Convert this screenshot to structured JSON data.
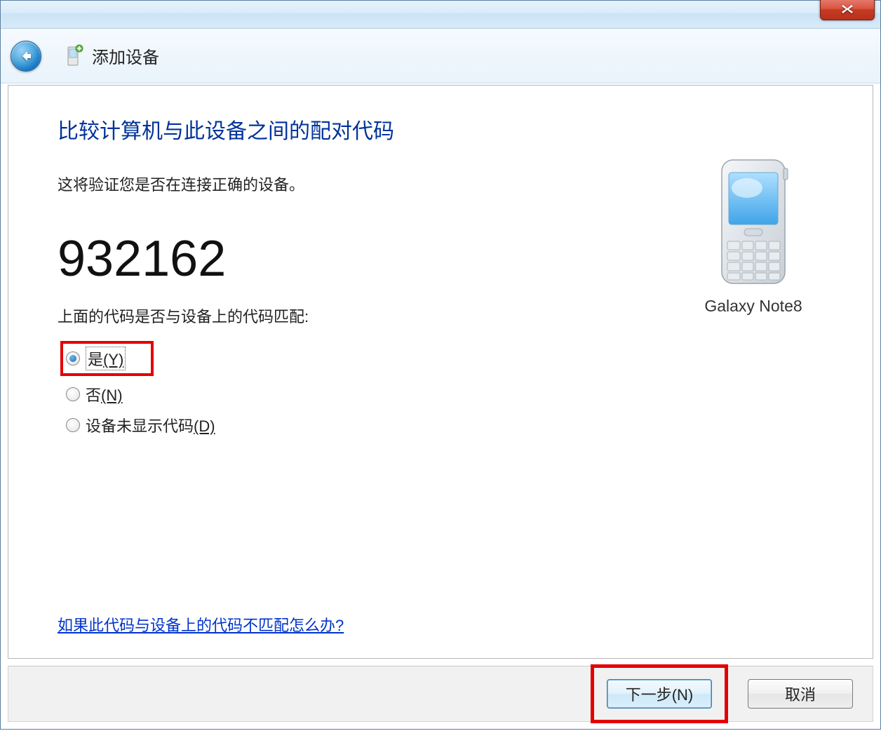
{
  "navbar": {
    "title": "添加设备"
  },
  "main": {
    "heading": "比较计算机与此设备之间的配对代码",
    "subtext": "这将验证您是否在连接正确的设备。",
    "pairing_code": "932162",
    "question": "上面的代码是否与设备上的代码匹配:",
    "options": {
      "yes": {
        "text": "是",
        "accel": "(Y)",
        "selected": true
      },
      "no": {
        "text": "否",
        "accel": "(N)",
        "selected": false
      },
      "nocode": {
        "text": "设备未显示代码",
        "accel": "(D)",
        "selected": false
      }
    },
    "help_link": "如果此代码与设备上的代码不匹配怎么办?"
  },
  "device": {
    "name": "Galaxy Note8"
  },
  "buttons": {
    "next": "下一步(N)",
    "cancel": "取消"
  }
}
